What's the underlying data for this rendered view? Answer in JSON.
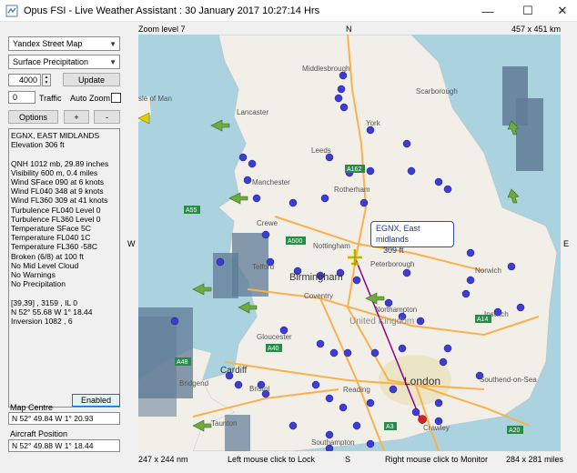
{
  "window": {
    "title": "Opus FSI - Live Weather Assistant : 30 January 2017  10:27:14 Hrs",
    "minimize_glyph": "—",
    "maximize_glyph": "☐",
    "close_glyph": "✕"
  },
  "controls": {
    "map_provider": "Yandex Street Map",
    "overlay": "Surface Precipitation",
    "altitude_value": "4000",
    "update_label": "Update",
    "traffic_value": "0",
    "traffic_label": "Traffic",
    "auto_zoom_label": "Auto Zoom",
    "options_label": "Options",
    "zoom_in_label": "+",
    "zoom_out_label": "-"
  },
  "report": {
    "lines": [
      "EGNX, EAST MIDLANDS",
      "Elevation 306 ft",
      "",
      "QNH 1012 mb, 29.89 inches",
      "Visibility 600 m, 0.4 miles",
      "Wind SFace 090 at 6 knots",
      "Wind FL040 348 at 9 knots",
      "Wind FL360 309 at 41 knots",
      "Turbulence FL040 Level 0",
      "Turbulence FL360 Level 0",
      "Temperature SFace 5C",
      "Temperature FL040 1C",
      "Temperature FL360 -58C",
      "Broken (6/8) at 100 ft",
      "No Mid Level Cloud",
      "No Warnings",
      "No Precipitation",
      "",
      "[39,39] , 3159 , IL 0",
      "N 52° 55.68  W 1° 18.44",
      "Inversion 1082 , 6"
    ]
  },
  "map_centre": {
    "label": "Map Centre",
    "enabled_label": "Enabled",
    "value": "N 52° 49.84  W 1° 20.93"
  },
  "aircraft_position": {
    "label": "Aircraft Position",
    "value": "N 52° 49.88  W 1° 18.44"
  },
  "map": {
    "zoom_label": "Zoom level 7",
    "size_nm_top": "457 x 451 km",
    "compass_n": "N",
    "compass_s": "S",
    "compass_w": "W",
    "compass_e": "E",
    "size_nm_bottom": "247 x 244 nm",
    "left_click_hint": "Left mouse click to Lock",
    "right_click_hint": "Right mouse click to Monitor",
    "size_miles": "284 x 281 miles",
    "callout_title": "EGNX, East midlands",
    "callout_elev": "309 ft",
    "place_labels": [
      "Middlesbrough",
      "Scarborough",
      "Lancaster",
      "York",
      "Leeds",
      "Manchester",
      "Rotherham",
      "Crewe",
      "Nottingham",
      "Norwich",
      "Telford",
      "Birmingham",
      "Peterborough",
      "Coventry",
      "Northampton",
      "United Kingdom",
      "Ipswich",
      "Gloucester",
      "Cardiff",
      "Bristol",
      "Reading",
      "London",
      "Southend-on-Sea",
      "Taunton",
      "Southampton",
      "Crawley",
      "Bridgend",
      "Isle of Man"
    ],
    "road_labels": [
      "A162",
      "A500",
      "A55",
      "A40",
      "A48",
      "A14",
      "A3",
      "A20"
    ],
    "colors": {
      "sea": "#aad3df",
      "land": "#f2efe9",
      "precip": "#5f7b95",
      "pin": "#3d3dd6",
      "route": "#8b008b",
      "destination_pin": "#d62020"
    }
  }
}
